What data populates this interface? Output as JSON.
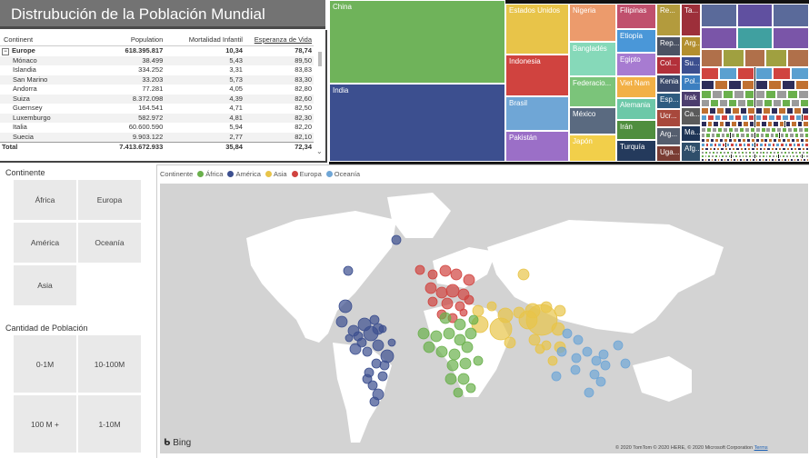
{
  "title": "Distrubución de la Población Mundial",
  "table": {
    "headers": [
      "Continent",
      "Population",
      "Mortalidad Infantil",
      "Esperanza de Vida"
    ],
    "group": {
      "name": "Europe",
      "population": "618.395.817",
      "mortality": "10,34",
      "life": "78,74"
    },
    "rows": [
      {
        "name": "Mónaco",
        "population": "38.499",
        "mortality": "5,43",
        "life": "89,50"
      },
      {
        "name": "Islandia",
        "population": "334.252",
        "mortality": "3,31",
        "life": "83,83"
      },
      {
        "name": "San Marino",
        "population": "33.203",
        "mortality": "5,73",
        "life": "83,30"
      },
      {
        "name": "Andorra",
        "population": "77.281",
        "mortality": "4,05",
        "life": "82,80"
      },
      {
        "name": "Suiza",
        "population": "8.372.098",
        "mortality": "4,39",
        "life": "82,60"
      },
      {
        "name": "Guernsey",
        "population": "164.541",
        "mortality": "4,71",
        "life": "82,50"
      },
      {
        "name": "Luxemburgo",
        "population": "582.972",
        "mortality": "4,81",
        "life": "82,30"
      },
      {
        "name": "Italia",
        "population": "60.600.590",
        "mortality": "5,94",
        "life": "82,20"
      },
      {
        "name": "Suecia",
        "population": "9.903.122",
        "mortality": "2,77",
        "life": "82,10"
      }
    ],
    "total": {
      "name": "Total",
      "population": "7.413.672.933",
      "mortality": "35,84",
      "life": "72,34"
    }
  },
  "treemap": {
    "labels": {
      "china": "China",
      "india": "India",
      "usa": "Estados Unidos",
      "indonesia": "Indonesia",
      "brasil": "Brasil",
      "pakistan": "Pakistán",
      "nigeria": "Nigeria",
      "bangladesh": "Bangladés",
      "federacion": "Federacio...",
      "mexico": "México",
      "japon": "Japón",
      "filipinas": "Filipinas",
      "etiopia": "Etiopía",
      "egipto": "Egipto",
      "vietnam": "Viet Nam",
      "alemania": "Alemania",
      "iran": "Irán",
      "turquia": "Turquía",
      "re": "Re...",
      "ta": "Ta...",
      "rep": "Rep...",
      "arg1": "Arg...",
      "col": "Col...",
      "su": "Su...",
      "pol": "Pol...",
      "kenia": "Kenia",
      "irak": "Irak",
      "esp": "Esp...",
      "ca": "Ca...",
      "ucr": "Ucr...",
      "ma": "Ma...",
      "arg2": "Arg...",
      "afg": "Afg...",
      "uga": "Uga..."
    },
    "colors": {
      "africa": "#6ab04c",
      "america": "#3c4f8f",
      "asia": "#e8c449",
      "europa": "#d0433f",
      "oceania": "#6fa6d6"
    }
  },
  "slicers": {
    "continent_label": "Continente",
    "continents": [
      "África",
      "Europa",
      "América",
      "Oceanía",
      "Asia"
    ],
    "population_label": "Cantidad de Población",
    "population_ranges": [
      "0-1M",
      "10-100M",
      "100 M +",
      "1-10M"
    ]
  },
  "map": {
    "legend_title": "Continente",
    "legend": [
      {
        "name": "África",
        "color": "#6ab04c"
      },
      {
        "name": "América",
        "color": "#3c4f8f"
      },
      {
        "name": "Asia",
        "color": "#e8c449"
      },
      {
        "name": "Europa",
        "color": "#d0433f"
      },
      {
        "name": "Oceanía",
        "color": "#6fa6d6"
      }
    ],
    "bing": "Bing",
    "copyright": "© 2020 TomTom © 2020 HERE, © 2020 Microsoft Corporation",
    "terms": "Terms"
  }
}
